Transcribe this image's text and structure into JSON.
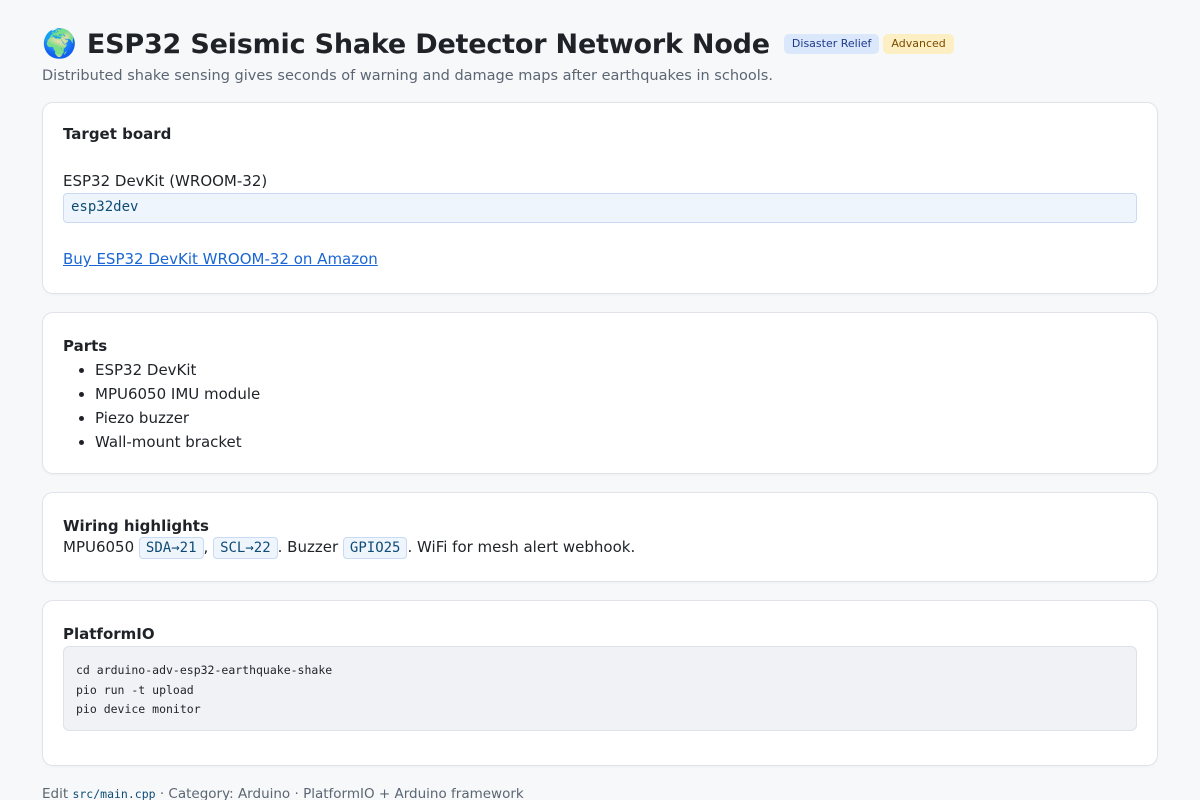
{
  "header": {
    "icon": "globe-icon",
    "title": "ESP32 Seismic Shake Detector Network Node",
    "badges": {
      "topic": "Disaster Relief",
      "level": "Advanced"
    },
    "subtitle": "Distributed shake sensing gives seconds of warning and damage maps after earthquakes in schools."
  },
  "target_board": {
    "heading": "Target board",
    "name": "ESP32 DevKit (WROOM-32)",
    "id": "esp32dev",
    "link_text": "Buy ESP32 DevKit WROOM-32 on Amazon"
  },
  "parts": {
    "heading": "Parts",
    "items": [
      "ESP32 DevKit",
      "MPU6050 IMU module",
      "Piezo buzzer",
      "Wall-mount bracket"
    ]
  },
  "wiring": {
    "heading": "Wiring highlights",
    "prefix": "MPU6050",
    "sda": "SDA→21",
    "sep1": ",",
    "scl": "SCL→22",
    "mid": ". Buzzer",
    "buzzer_pin": "GPIO25",
    "suffix": ". WiFi for mesh alert webhook."
  },
  "platformio": {
    "heading": "PlatformIO",
    "commands": [
      "cd arduino-adv-esp32-earthquake-shake",
      "pio run -t upload",
      "pio device monitor"
    ]
  },
  "footer": {
    "edit_label": "Edit",
    "file": "src/main.cpp",
    "rest": "· Category: Arduino · PlatformIO + Arduino framework"
  },
  "colors": {
    "link": "#1a66d2",
    "badge_topic_bg": "#dbe7fb",
    "badge_level_bg": "#fcefc4"
  }
}
